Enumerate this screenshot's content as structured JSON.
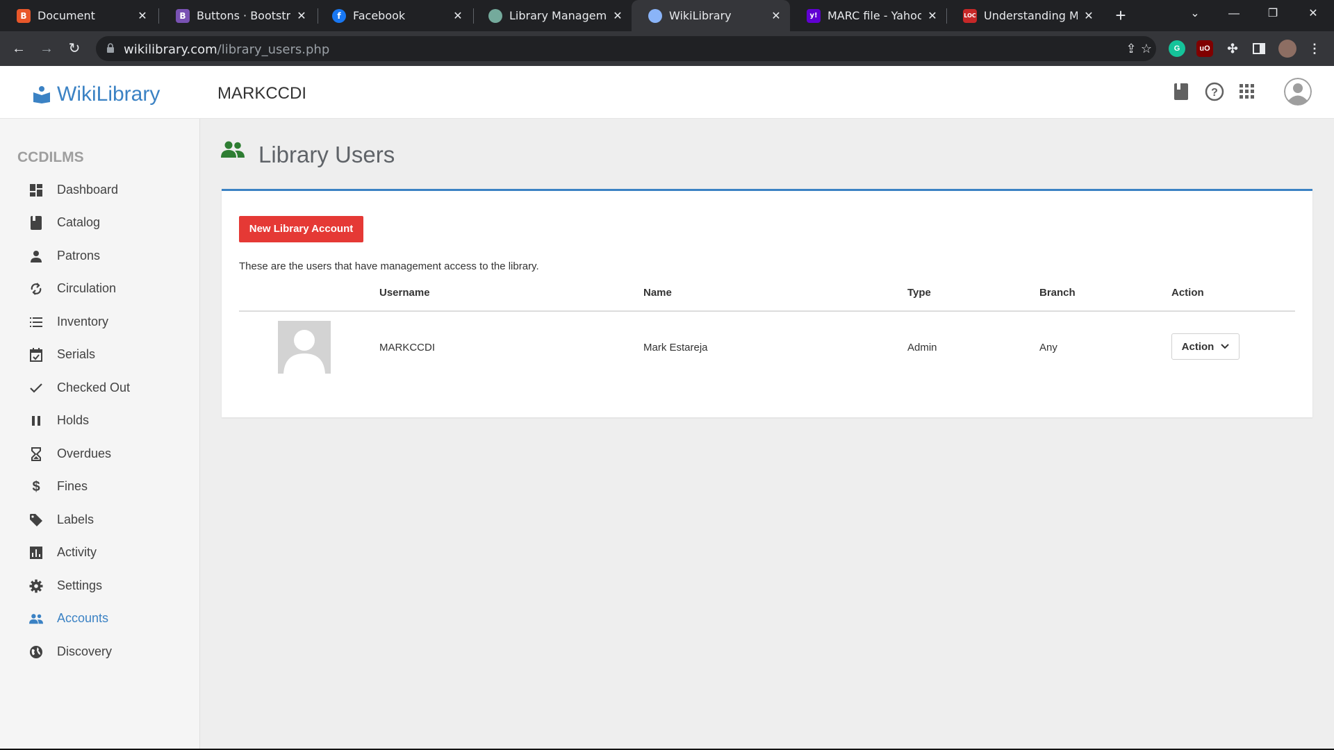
{
  "browser": {
    "tabs": [
      {
        "label": "Document",
        "favicon_text": "B",
        "favicon_color": "#e8572a"
      },
      {
        "label": "Buttons · Bootstrap v",
        "favicon_text": "B",
        "favicon_color": "#7952b3"
      },
      {
        "label": "Facebook",
        "favicon_text": "f",
        "favicon_color": "#1877f2"
      },
      {
        "label": "Library Management",
        "favicon_text": "",
        "favicon_color": "#74aa9c"
      },
      {
        "label": "WikiLibrary",
        "favicon_text": "",
        "favicon_color": "#8ab4f8"
      },
      {
        "label": "MARC file - Yahoo Se",
        "favicon_text": "y!",
        "favicon_color": "#6001d2"
      },
      {
        "label": "Understanding MARC",
        "favicon_text": "LOC",
        "favicon_color": "#c62828"
      }
    ],
    "url_host": "wikilibrary.com",
    "url_path": "/library_users.php"
  },
  "header": {
    "brand": "WikiLibrary",
    "account_name": "MARKCCDI"
  },
  "sidebar": {
    "heading": "CCDILMS",
    "items": [
      {
        "label": "Dashboard",
        "icon": "dashboard-icon"
      },
      {
        "label": "Catalog",
        "icon": "book-icon"
      },
      {
        "label": "Patrons",
        "icon": "person-icon"
      },
      {
        "label": "Circulation",
        "icon": "sync-icon"
      },
      {
        "label": "Inventory",
        "icon": "list-icon"
      },
      {
        "label": "Serials",
        "icon": "calendar-check-icon"
      },
      {
        "label": "Checked Out",
        "icon": "check-icon"
      },
      {
        "label": "Holds",
        "icon": "pause-icon"
      },
      {
        "label": "Overdues",
        "icon": "hourglass-icon"
      },
      {
        "label": "Fines",
        "icon": "dollar-icon"
      },
      {
        "label": "Labels",
        "icon": "tag-icon"
      },
      {
        "label": "Activity",
        "icon": "chart-icon"
      },
      {
        "label": "Settings",
        "icon": "gear-icon"
      },
      {
        "label": "Accounts",
        "icon": "people-icon",
        "active": true
      },
      {
        "label": "Discovery",
        "icon": "globe-icon"
      }
    ],
    "active_color": "#3b82c4"
  },
  "page": {
    "title": "Library Users",
    "new_account_label": "New Library Account",
    "description": "These are the users that have management access to the library.",
    "columns": [
      "Username",
      "Name",
      "Type",
      "Branch",
      "Action"
    ],
    "rows": [
      {
        "username": "MARKCCDI",
        "name": "Mark Estareja",
        "type": "Admin",
        "branch": "Any",
        "action_label": "Action"
      }
    ]
  },
  "colors": {
    "accent": "#3b82c4",
    "danger": "#e53935",
    "title_icon": "#2e7d32"
  }
}
